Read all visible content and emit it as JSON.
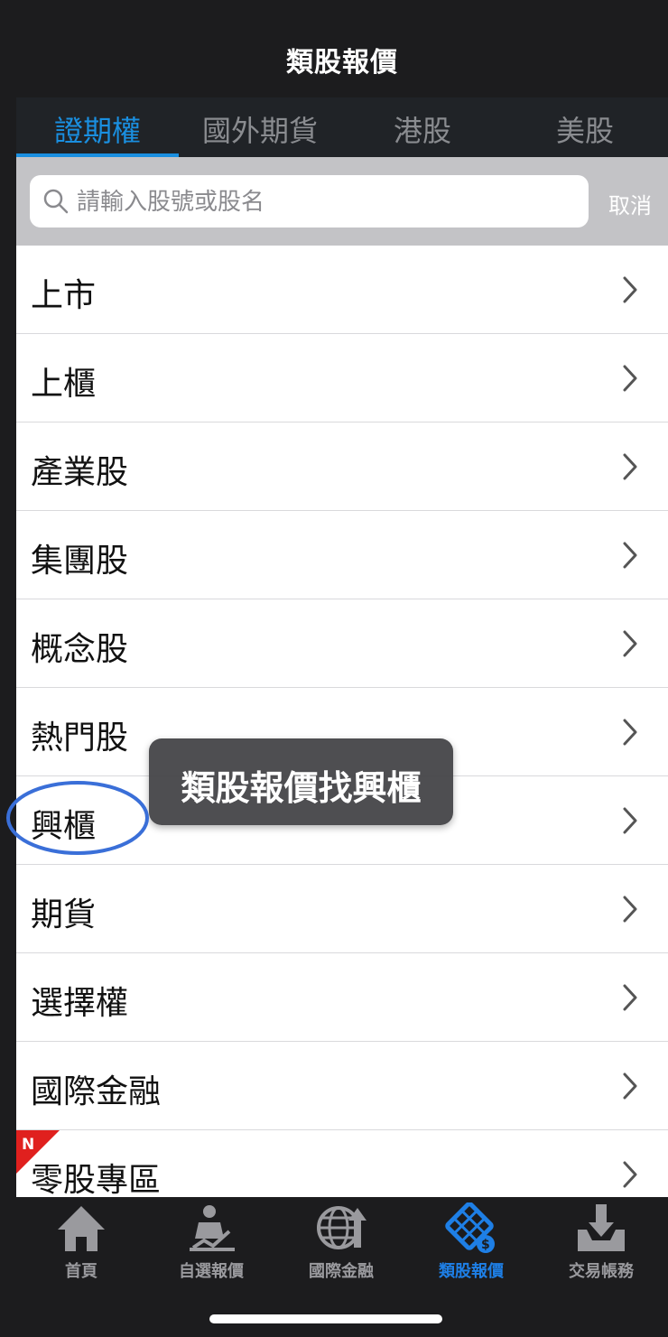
{
  "header": {
    "title": "類股報價"
  },
  "tabs": [
    {
      "label": "證期權",
      "active": true
    },
    {
      "label": "國外期貨",
      "active": false
    },
    {
      "label": "港股",
      "active": false
    },
    {
      "label": "美股",
      "active": false
    }
  ],
  "search": {
    "placeholder": "請輸入股號或股名",
    "cancel_label": "取消"
  },
  "list": [
    {
      "label": "上市"
    },
    {
      "label": "上櫃"
    },
    {
      "label": "產業股"
    },
    {
      "label": "集團股"
    },
    {
      "label": "概念股"
    },
    {
      "label": "熱門股"
    },
    {
      "label": "興櫃"
    },
    {
      "label": "期貨"
    },
    {
      "label": "選擇權"
    },
    {
      "label": "國際金融"
    },
    {
      "label": "零股專區",
      "badge": "N"
    }
  ],
  "tooltip": {
    "text": "類股報價找興櫃"
  },
  "bottom_nav": [
    {
      "label": "首頁",
      "icon": "home-icon"
    },
    {
      "label": "自選報價",
      "icon": "person-chart-icon"
    },
    {
      "label": "國際金融",
      "icon": "globe-icon"
    },
    {
      "label": "類股報價",
      "icon": "film-dollar-icon",
      "active": true
    },
    {
      "label": "交易帳務",
      "icon": "inbox-download-icon"
    }
  ],
  "colors": {
    "accent": "#1a8fe0",
    "badge": "#e0201e",
    "highlight_circle": "#3a6fd8"
  }
}
